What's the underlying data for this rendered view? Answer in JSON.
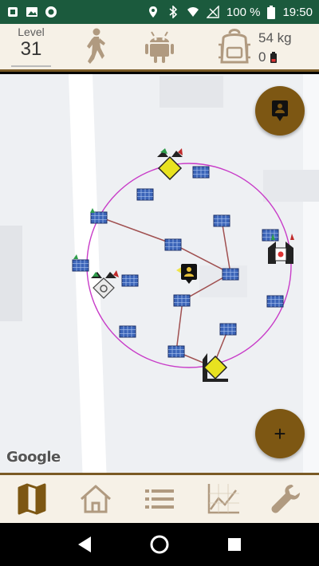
{
  "statusbar": {
    "battery_text": "100 %",
    "time": "19:50",
    "icons": [
      "notification-square-icon",
      "image-icon",
      "record-icon",
      "location-pin-icon",
      "bluetooth-icon",
      "wifi-icon",
      "signal-off-icon",
      "battery-icon"
    ]
  },
  "header": {
    "level_label": "Level",
    "level_value": "31",
    "weight": "54 kg",
    "coins": "0",
    "icons": [
      "hiker-icon",
      "android-icon",
      "backpack-icon",
      "battery-small-icon"
    ]
  },
  "map": {
    "provider": "Google",
    "fab_top_icon": "badge-icon",
    "fab_add_label": "+"
  },
  "bottomnav": {
    "items": [
      "map-icon",
      "home-icon",
      "list-icon",
      "chart-icon",
      "wrench-icon"
    ]
  },
  "colors": {
    "statusbar": "#1b5a3d",
    "accent": "#7d5713",
    "bar_bg": "#f6f1e7",
    "circle": "#c83cc8",
    "link": "#a05050"
  }
}
